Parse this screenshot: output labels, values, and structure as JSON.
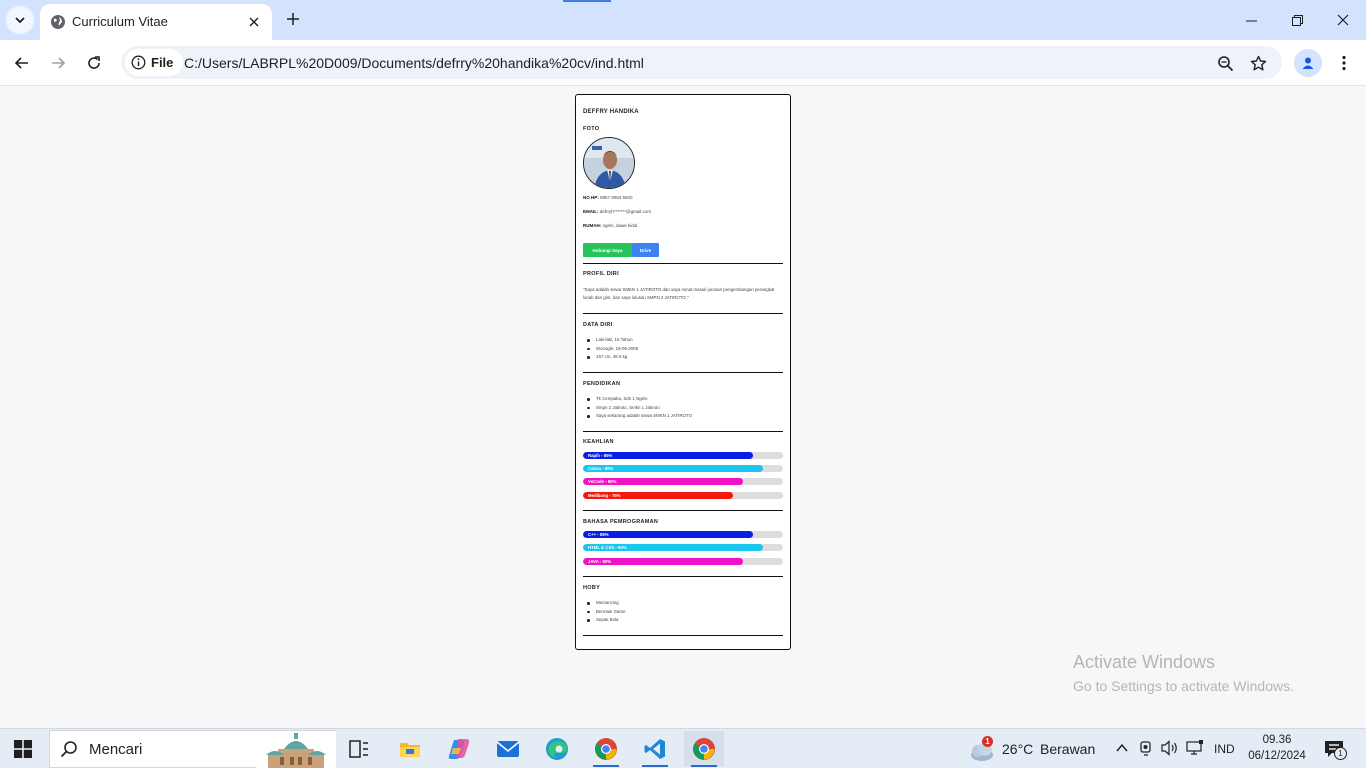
{
  "browser": {
    "tab_title": "Curriculum Vitae",
    "site_chip_label": "File",
    "url": "C:/Users/LABRPL%20D009/Documents/defrry%20handika%20cv/ind.html"
  },
  "cv": {
    "name": "DEFFRY HANDIKA",
    "foto_title": "FOTO",
    "contact": {
      "phone_label": "NO HP:",
      "phone_value": "0857 8094 5920",
      "email_label": "EMAIL:",
      "email_value": "defrryh*******@gmail.com",
      "home_label": "RUMAH:",
      "home_value": "ngelo, dawe kidul"
    },
    "buttons": {
      "contact": "Hubungi Saya",
      "drive": "Drive"
    },
    "profile": {
      "title": "PROFIL DIRI",
      "text": "\"Saya adalah siswa SMKN 1 JATIROTO dan saya minat masuk jurusan pengembangan perangkat lunak dan gim, dan saya lulusan SMPN 2 JATIROTO.\""
    },
    "personal": {
      "title": "DATA DIRI",
      "items": [
        "Laki-laki, 16 Tahun",
        "Wonogiri, 18-06-2008",
        "167 cm, 46.6 kg"
      ]
    },
    "education": {
      "title": "PENDIDIKAN",
      "items": [
        "Tk Cempaka, Sdn 1 Ngelo",
        "Smpn 2 Jatiroto, Smkn 1 Jatiroto",
        "Saya sekarang adalah siswa SMKN 1 JATIROTO"
      ]
    },
    "skills": {
      "title": "KEAHLIAN",
      "items": [
        {
          "label": "Rapih - 85%",
          "value": 85,
          "color": "#0a1fe6"
        },
        {
          "label": "Canva - 90%",
          "value": 90,
          "color": "#18c6ee"
        },
        {
          "label": "VsCode - 80%",
          "value": 80,
          "color": "#f012c8"
        },
        {
          "label": "Medibang - 75%",
          "value": 75,
          "color": "#f21a0c"
        }
      ]
    },
    "languages": {
      "title": "BAHASA PEMROGRAMAN",
      "items": [
        {
          "label": "C++ - 85%",
          "value": 85,
          "color": "#0a1fe6"
        },
        {
          "label": "HTML & CSS - 90%",
          "value": 90,
          "color": "#18c6ee"
        },
        {
          "label": "JAVA - 80%",
          "value": 80,
          "color": "#f012c8"
        }
      ]
    },
    "hobby": {
      "title": "HOBY",
      "items": [
        "Memancing",
        "Bermain Game",
        "Sepak Bola"
      ]
    }
  },
  "watermark": {
    "title": "Activate Windows",
    "subtitle": "Go to Settings to activate Windows."
  },
  "taskbar": {
    "search_placeholder": "Mencari",
    "weather_temp": "26°C",
    "weather_desc": "Berawan",
    "weather_badge": "1",
    "language": "IND",
    "time": "09.36",
    "date": "06/12/2024",
    "notification_count": "1"
  }
}
